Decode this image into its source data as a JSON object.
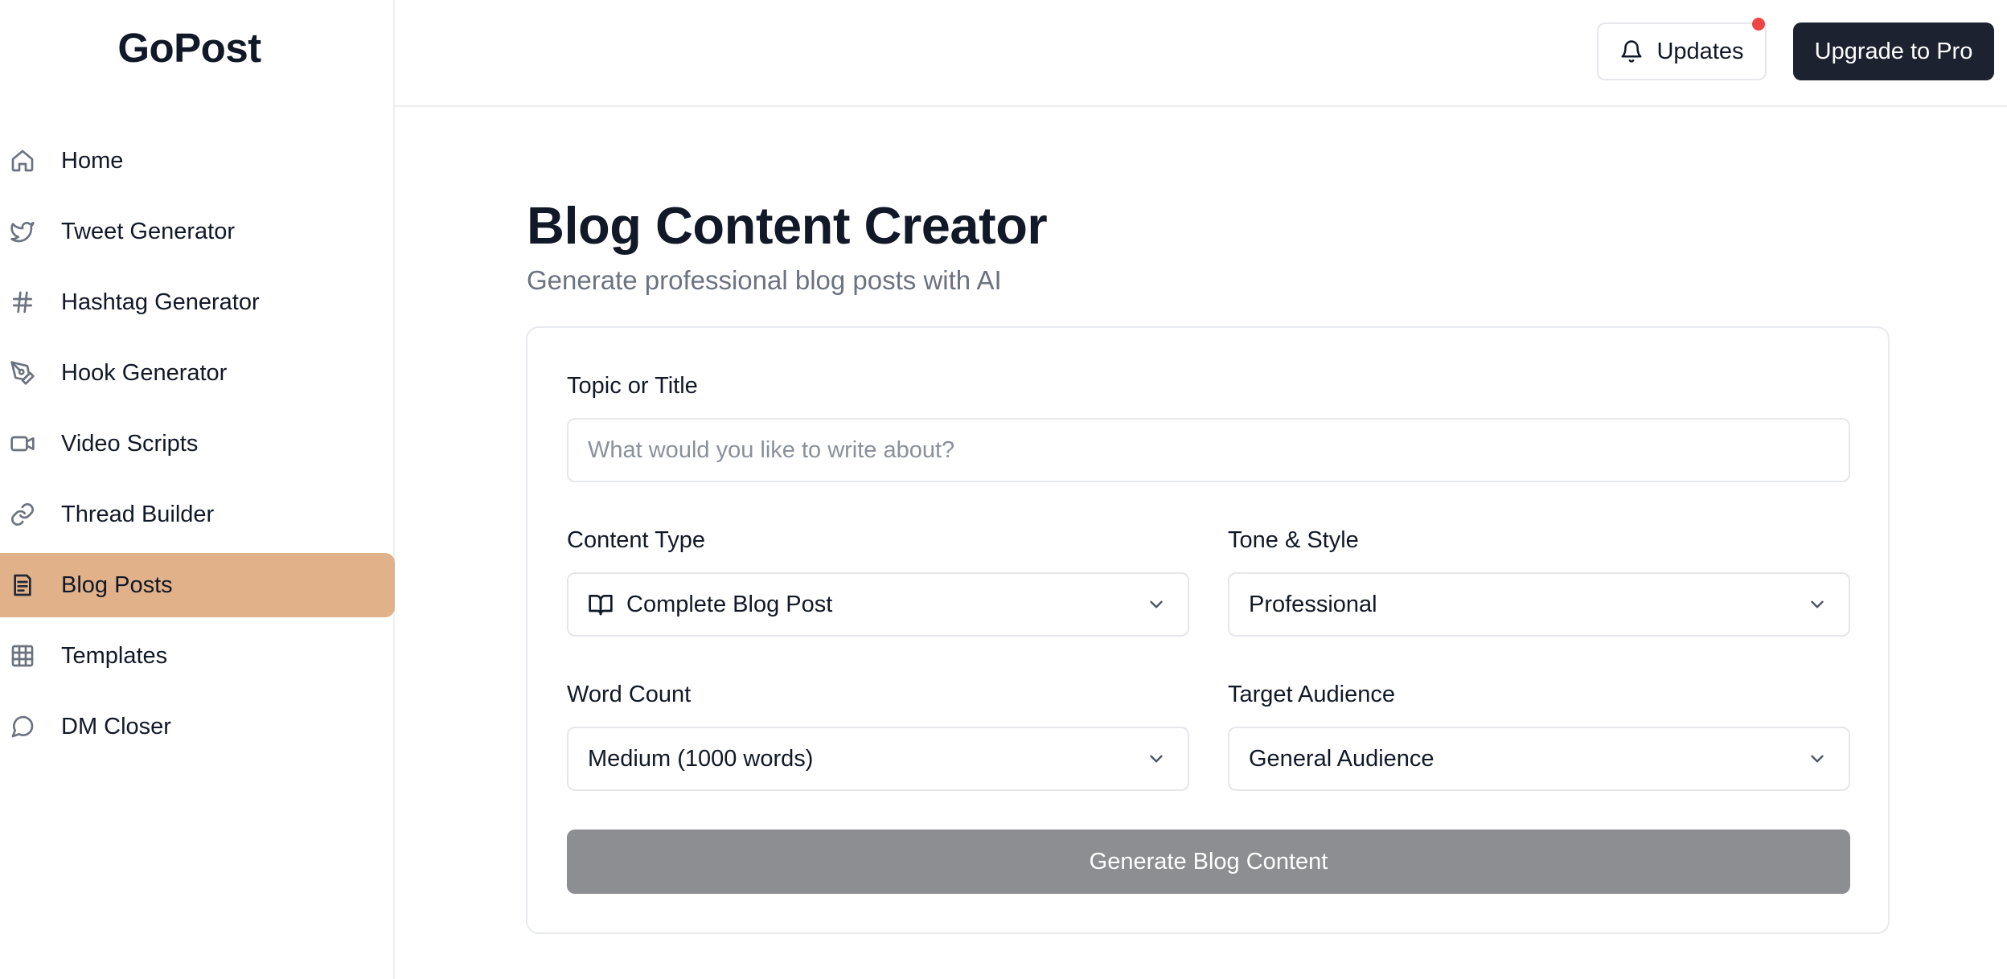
{
  "brand": {
    "name": "GoPost"
  },
  "sidebar": {
    "items": [
      {
        "label": "Home",
        "icon": "home-icon"
      },
      {
        "label": "Tweet Generator",
        "icon": "twitter-icon"
      },
      {
        "label": "Hashtag Generator",
        "icon": "hash-icon"
      },
      {
        "label": "Hook Generator",
        "icon": "pen-tool-icon"
      },
      {
        "label": "Video Scripts",
        "icon": "video-icon"
      },
      {
        "label": "Thread Builder",
        "icon": "link-icon"
      },
      {
        "label": "Blog Posts",
        "icon": "document-icon",
        "active": true
      },
      {
        "label": "Templates",
        "icon": "grid-icon"
      },
      {
        "label": "DM Closer",
        "icon": "message-circle-icon"
      }
    ],
    "active_color": "#e1b289"
  },
  "topbar": {
    "updates_label": "Updates",
    "upgrade_label": "Upgrade to Pro",
    "notification_color": "#ef4444"
  },
  "main": {
    "title": "Blog Content Creator",
    "subtitle": "Generate professional blog posts with AI",
    "form": {
      "topic_label": "Topic or Title",
      "topic_placeholder": "What would you like to write about?",
      "topic_value": "",
      "content_type_label": "Content Type",
      "content_type_value": "Complete Blog Post",
      "tone_label": "Tone & Style",
      "tone_value": "Professional",
      "word_count_label": "Word Count",
      "word_count_value": "Medium (1000 words)",
      "audience_label": "Target Audience",
      "audience_value": "General Audience",
      "generate_label": "Generate Blog Content",
      "generate_color": "#8d8e92"
    }
  }
}
